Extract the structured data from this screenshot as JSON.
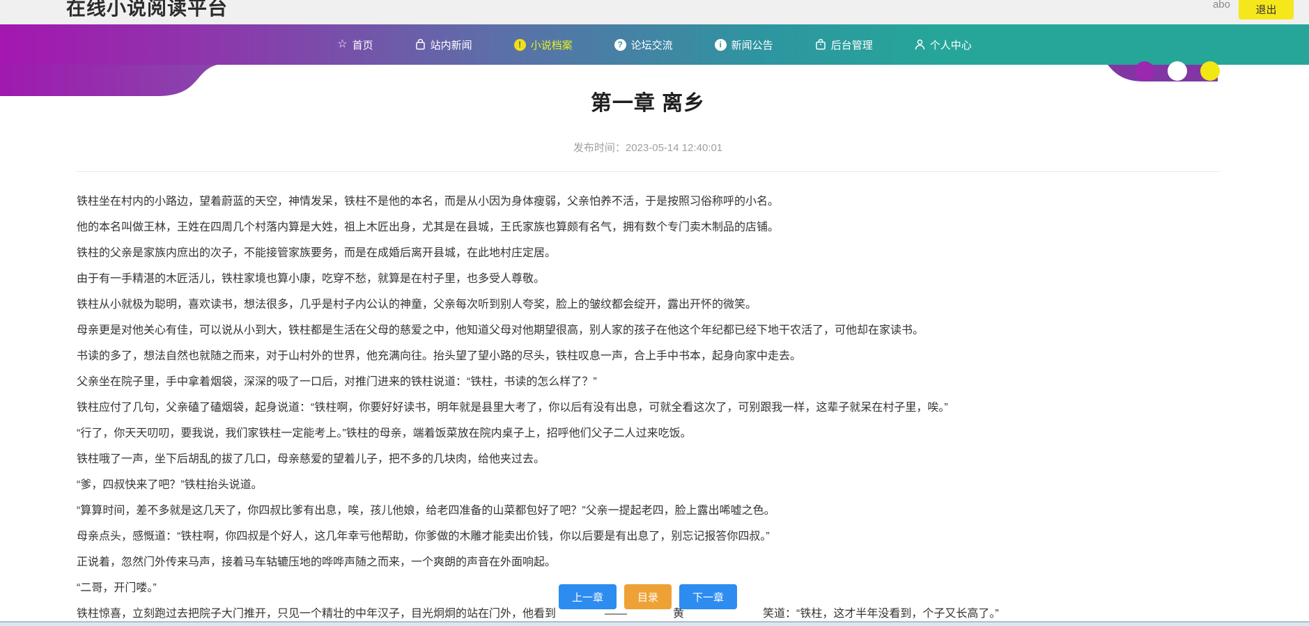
{
  "site": {
    "title": "在线小说阅读平台",
    "username": "abo",
    "logout_label": "退出"
  },
  "nav": {
    "items": [
      {
        "label": "首页",
        "icon": "star-icon",
        "active": false
      },
      {
        "label": "站内新闻",
        "icon": "bag-icon",
        "active": false
      },
      {
        "label": "小说档案",
        "icon": "exclamation-circle-icon",
        "active": true
      },
      {
        "label": "论坛交流",
        "icon": "question-circle-icon",
        "active": false
      },
      {
        "label": "新闻公告",
        "icon": "info-circle-icon",
        "active": false
      },
      {
        "label": "后台管理",
        "icon": "briefcase-icon",
        "active": false
      },
      {
        "label": "个人中心",
        "icon": "user-icon",
        "active": false
      }
    ],
    "icon_glyphs": {
      "star": "☆",
      "exclamation": "!",
      "question": "?",
      "info": "i"
    },
    "decorative_dot_colors": [
      "#9c27b0",
      "#ffffff",
      "#f3e713"
    ]
  },
  "colors": {
    "nav_gradient_start": "#a417b0",
    "nav_gradient_end": "#26a699",
    "nav_active_text": "#e8f021",
    "logout_button": "#f6e71d",
    "pager_blue": "#2d8cf0",
    "pager_orange": "#eea236"
  },
  "chapter": {
    "title": "第一章 离乡",
    "publish_time_label": "发布时间：",
    "publish_time": "2023-05-14 12:40:01",
    "paragraphs": [
      "铁柱坐在村内的小路边，望着蔚蓝的天空，神情发呆，铁柱不是他的本名，而是从小因为身体瘦弱，父亲怕养不活，于是按照习俗称呼的小名。",
      "他的本名叫做王林，王姓在四周几个村落内算是大姓，祖上木匠出身，尤其是在县城，王氏家族也算颇有名气，拥有数个专门卖木制品的店铺。",
      "铁柱的父亲是家族内庶出的次子，不能接管家族要务，而是在成婚后离开县城，在此地村庄定居。",
      "由于有一手精湛的木匠活儿，铁柱家境也算小康，吃穿不愁，就算是在村子里，也多受人尊敬。",
      "铁柱从小就极为聪明，喜欢读书，想法很多，几乎是村子内公认的神童，父亲每次听到别人夸奖，脸上的皱纹都会绽开，露出开怀的微笑。",
      "母亲更是对他关心有佳，可以说从小到大，铁柱都是生活在父母的慈爱之中，他知道父母对他期望很高，别人家的孩子在他这个年纪都已经下地干农活了，可他却在家读书。",
      "书读的多了，想法自然也就随之而来，对于山村外的世界，他充满向往。抬头望了望小路的尽头，铁柱叹息一声，合上手中书本，起身向家中走去。",
      "父亲坐在院子里，手中拿着烟袋，深深的吸了一口后，对推门进来的铁柱说道：“铁柱，书读的怎么样了？”",
      "铁柱应付了几句，父亲磕了磕烟袋，起身说道：“铁柱啊，你要好好读书，明年就是县里大考了，你以后有没有出息，可就全看这次了，可别跟我一样，这辈子就呆在村子里，唉。”",
      "“行了，你天天叨叨，要我说，我们家铁柱一定能考上。”铁柱的母亲，端着饭菜放在院内桌子上，招呼他们父子二人过来吃饭。",
      "铁柱哦了一声，坐下后胡乱的拔了几口，母亲慈爱的望着儿子，把不多的几块肉，给他夹过去。",
      "“爹，四叔快来了吧？”铁柱抬头说道。",
      "“算算时间，差不多就是这几天了，你四叔比爹有出息，唉，孩儿他娘，给老四准备的山菜都包好了吧？”父亲一提起老四，脸上露出唏嘘之色。",
      "母亲点头，感慨道：“铁柱啊，你四叔是个好人，这几年幸亏他帮助，你爹做的木雕才能卖出价钱，你以后要是有出息了，别忘记报答你四叔。”",
      "正说着，忽然门外传来马声，接着马车轱辘压地的哗哗声随之而来，一个爽朗的声音在外面响起。",
      "“二哥，开门喽。”"
    ],
    "last_line_fragments": {
      "visible_start": "铁柱惊喜，立刻跑过去把院子大门推开，只见一个精壮的中年汉子，目光炯炯的站在门外，他看到",
      "visible_dash": "——",
      "visible_char": "黄",
      "visible_end": "笑道：“铁柱，这才半年没看到，个子又长高了。”"
    }
  },
  "pager": {
    "prev_label": "上一章",
    "toc_label": "目录",
    "next_label": "下一章"
  }
}
